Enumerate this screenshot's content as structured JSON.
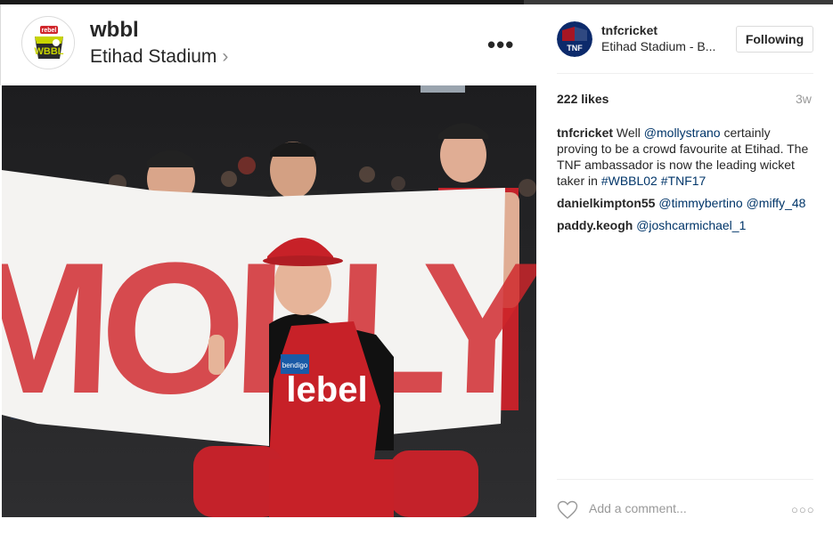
{
  "post": {
    "username": "wbbl",
    "location": "Etihad Stadium",
    "more_label": "•••",
    "avatar_text": "rebel"
  },
  "sidebar": {
    "username": "tnfcricket",
    "location": "Etihad Stadium - B...",
    "follow_label": "Following",
    "avatar_text": "TNF",
    "likes": "222 likes",
    "time": "3w",
    "add_comment_placeholder": "Add a comment...",
    "options_label": "○○○"
  },
  "comments": [
    {
      "user": "tnfcricket",
      "parts": [
        {
          "text": "Well ",
          "link": false
        },
        {
          "text": "@mollystrano",
          "link": true
        },
        {
          "text": " certainly proving to be a crowd favourite at Etihad. The TNF ambassador is now the leading wicket taker in ",
          "link": false
        },
        {
          "text": "#WBBL02",
          "link": true
        },
        {
          "text": " ",
          "link": false
        },
        {
          "text": "#TNF17",
          "link": true
        }
      ]
    },
    {
      "user": "danielkimpton55",
      "parts": [
        {
          "text": "@timmybertino",
          "link": true
        },
        {
          "text": " ",
          "link": false
        },
        {
          "text": "@miffy_48",
          "link": true
        }
      ]
    },
    {
      "user": "paddy.keogh",
      "parts": [
        {
          "text": "@joshcarmichael_1",
          "link": true
        }
      ]
    }
  ],
  "photo": {
    "banner_text": "MOLLY",
    "jersey_text": "lebel",
    "sponsor_text": "bendigo"
  },
  "colors": {
    "link": "#003569",
    "renegades_red": "#d0262b",
    "border": "#dbdbdb"
  }
}
